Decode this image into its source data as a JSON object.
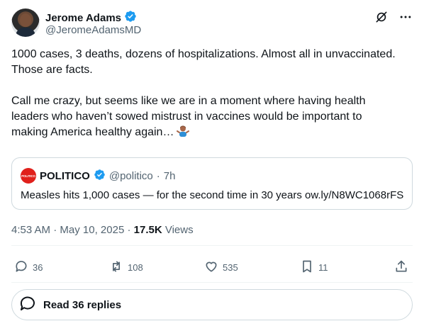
{
  "author": {
    "display_name": "Jerome Adams",
    "handle": "@JeromeAdamsMD",
    "verified": true
  },
  "tweet": {
    "line1": "1000 cases, 3 deaths, dozens of hospitalizations. Almost all in unvaccinated.",
    "line2": "Those are facts.",
    "line3": "Call me crazy, but seems like we are in a moment where having health",
    "line4": "leaders who haven’t sowed mistrust in vaccines would be important to",
    "line5": "making America healthy again…",
    "emoji": "person-shrugging-emoji"
  },
  "quote": {
    "logo_text": "POLITICO",
    "name": "POLITICO",
    "handle": "@politico",
    "separator": "·",
    "age": "7h",
    "text": "Measles hits 1,000 cases — for the second time in 30 years ow.ly/N8WC1068rFS"
  },
  "meta": {
    "time": "4:53 AM",
    "sep1": "·",
    "date": "May 10, 2025",
    "sep2": "·",
    "views_count": "17.5K",
    "views_label": "Views"
  },
  "actions": {
    "replies": "36",
    "reposts": "108",
    "likes": "535",
    "bookmarks": "11"
  },
  "read_replies": {
    "label": "Read 36 replies"
  },
  "colors": {
    "text": "#0f1419",
    "secondary": "#536471",
    "verified_blue": "#1d9bf0",
    "politico_red": "#e0201b",
    "border": "#cfd9de"
  }
}
